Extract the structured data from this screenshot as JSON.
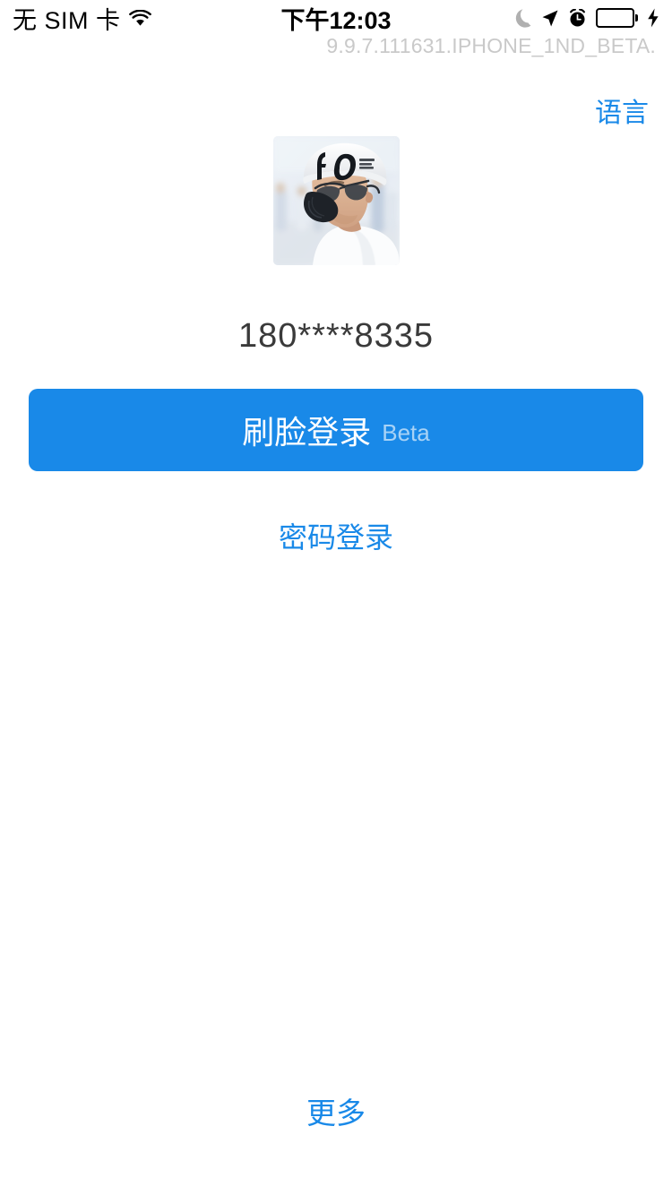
{
  "status_bar": {
    "carrier": "无 SIM 卡",
    "time": "下午12:03",
    "icons": {
      "wifi": "wifi-icon",
      "moon": "do-not-disturb-moon-icon",
      "location": "location-arrow-icon",
      "alarm": "alarm-clock-icon",
      "battery": "battery-icon",
      "charging": "charging-bolt-icon"
    },
    "battery_color": "#4CD663"
  },
  "version": {
    "text": "9.9.7.111631.IPHONE_1ND_BETA.",
    "color": "#c9c9c9"
  },
  "language": {
    "label": "语言",
    "color": "#1989E8"
  },
  "account": {
    "avatar_alt": "user-profile-photo",
    "masked_phone": "180****8335"
  },
  "actions": {
    "face_login": {
      "label": "刷脸登录",
      "badge": "Beta",
      "bg_color": "#1989E8",
      "text_color": "#ffffff"
    },
    "password_login": {
      "label": "密码登录",
      "color": "#1989E8"
    },
    "more": {
      "label": "更多",
      "color": "#1989E8"
    }
  }
}
